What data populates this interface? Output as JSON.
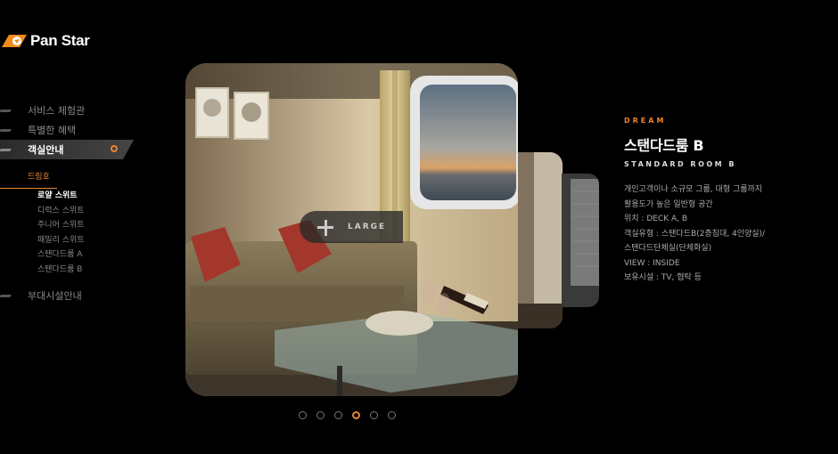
{
  "brand": {
    "name": "Pan Star"
  },
  "nav": {
    "items": [
      {
        "label": "서비스 체험관"
      },
      {
        "label": "특별한 혜택"
      },
      {
        "label": "객실안내"
      }
    ],
    "submenu": {
      "heading": "드림호",
      "items": [
        {
          "label": "로얄 스위트"
        },
        {
          "label": "디럭스 스위트"
        },
        {
          "label": "주니어 스위트"
        },
        {
          "label": "패밀리 스위트"
        },
        {
          "label": "스탠다드룸 A"
        },
        {
          "label": "스탠다드룸 B"
        }
      ]
    },
    "bottom_item": {
      "label": "부대시설안내"
    }
  },
  "gallery": {
    "enlarge_label": "LARGE",
    "page_count": 6,
    "current_page": 4
  },
  "room": {
    "eyebrow": "DREAM",
    "title": "스탠다드룸 B",
    "subtitle": "STANDARD ROOM B",
    "description": [
      "개인고객이나 소규모 그룹, 대형 그룹까지",
      "활용도가 높은 일반형 공간",
      "위치 : DECK A, B",
      "객실유형 : 스탠다드B(2층침대, 4인양실)/",
      "스탠다드단체실(단체화실)",
      "VIEW : INSIDE",
      "보유시설 : TV, 협탁 등"
    ]
  },
  "colors": {
    "accent": "#e8872f",
    "background": "#000000"
  }
}
